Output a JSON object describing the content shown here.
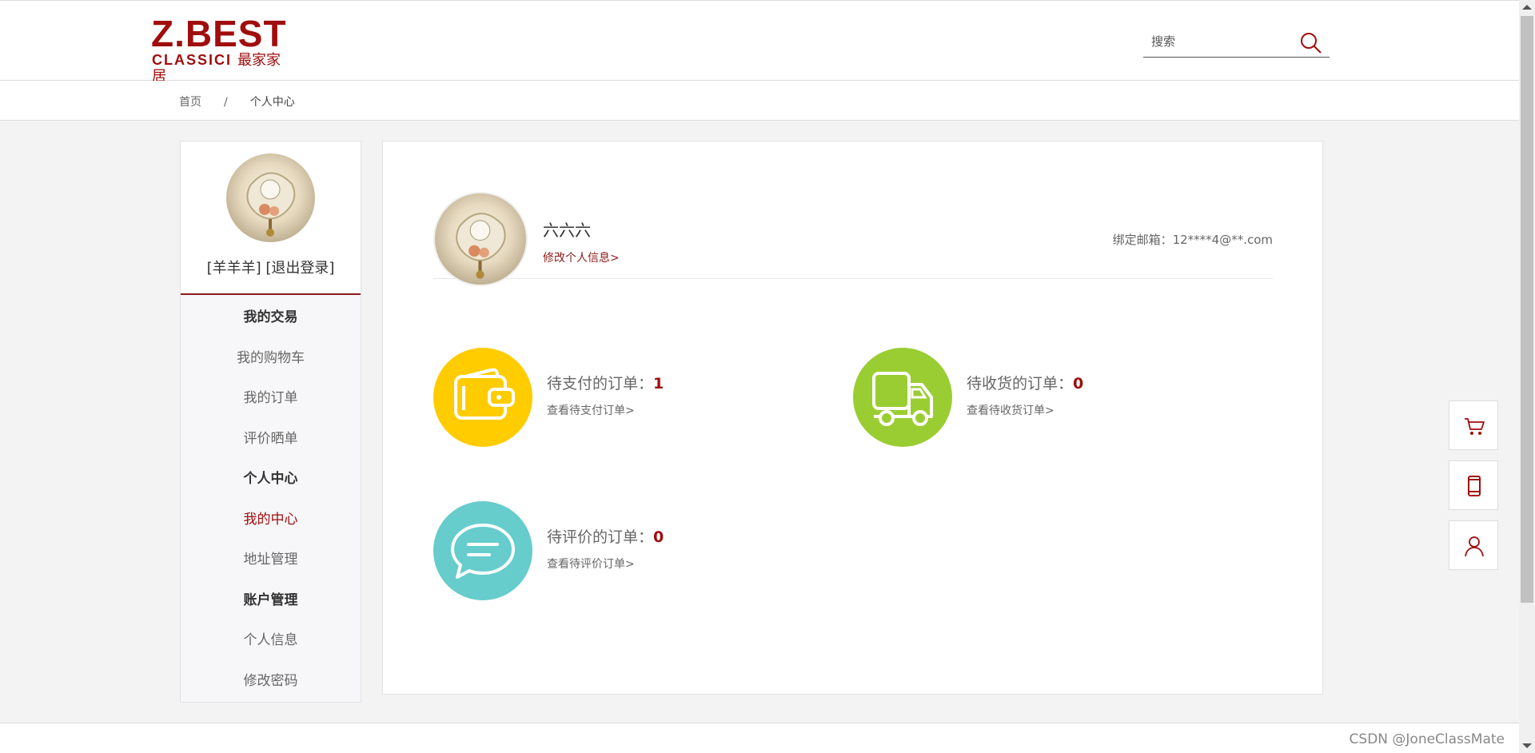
{
  "header": {
    "logo": {
      "main": "Z.BEST",
      "sub_latin": "CLASSICI",
      "sub_cn": "最家家居"
    },
    "search": {
      "placeholder": "搜索",
      "icon": "search-icon"
    }
  },
  "breadcrumb": {
    "home": "首页",
    "separator": "/",
    "current": "个人中心"
  },
  "sidebar": {
    "avatar_icon": "avatar",
    "user": {
      "name": "[羊羊羊]",
      "logout": "[退出登录]"
    },
    "menu": [
      {
        "label": "我的交易",
        "type": "group"
      },
      {
        "label": "我的购物车",
        "type": "item"
      },
      {
        "label": "我的订单",
        "type": "item"
      },
      {
        "label": "评价晒单",
        "type": "item"
      },
      {
        "label": "个人中心",
        "type": "group"
      },
      {
        "label": "我的中心",
        "type": "item",
        "active": true
      },
      {
        "label": "地址管理",
        "type": "item"
      },
      {
        "label": "账户管理",
        "type": "group"
      },
      {
        "label": "个人信息",
        "type": "item"
      },
      {
        "label": "修改密码",
        "type": "item"
      }
    ]
  },
  "profile": {
    "nickname": "六六六",
    "edit_link": "修改个人信息>",
    "email": "绑定邮箱：12****4@**.com"
  },
  "orders": [
    {
      "title": "待支付的订单：",
      "count": "1",
      "link": "查看待支付订单>",
      "icon": "wallet-icon",
      "color": "#ffcc00"
    },
    {
      "title": "待收货的订单：",
      "count": "0",
      "link": "查看待收货订单>",
      "icon": "truck-icon",
      "color": "#9acd32"
    },
    {
      "title": "待评价的订单：",
      "count": "0",
      "link": "查看待评价订单>",
      "icon": "chat-icon",
      "color": "#66cccc"
    }
  ],
  "tools": [
    {
      "icon": "cart-icon"
    },
    {
      "icon": "mobile-icon"
    },
    {
      "icon": "user-icon"
    }
  ],
  "footer": {
    "watermark": "CSDN @JoneClassMate"
  },
  "colors": {
    "brand": "#a00d0d",
    "background": "#f3f3f3"
  }
}
